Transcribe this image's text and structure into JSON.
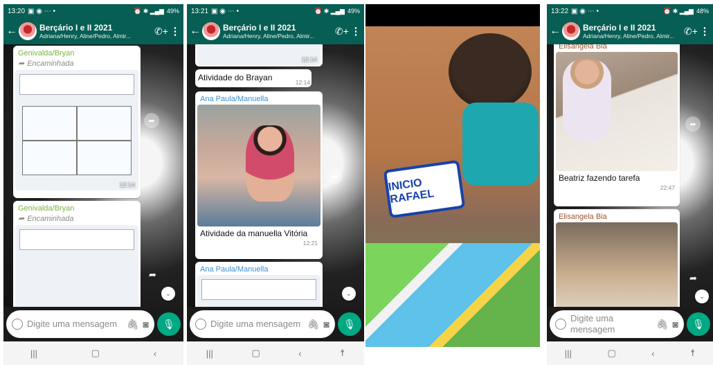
{
  "chat": {
    "title": "Berçário I e II 2021",
    "subtitle": "Adriana/Henry, Aline/Pedro, Almir..."
  },
  "input": {
    "placeholder": "Digite uma mensagem"
  },
  "screens": [
    {
      "status_time": "13:20",
      "battery": "49%",
      "messages": [
        {
          "sender": "Genivalda/Bryan",
          "forwarded": "Encaminhada",
          "time": "12:14"
        },
        {
          "sender": "Genivalda/Bryan",
          "forwarded": "Encaminhada"
        }
      ]
    },
    {
      "status_time": "13:21",
      "battery": "49%",
      "messages": [
        {
          "time": "12:14"
        },
        {
          "caption": "Atividade do Brayan",
          "time": "12:14"
        },
        {
          "sender": "Ana Paula/Manuella",
          "caption": "Atividade da manuella Vitória",
          "time": "12:21"
        },
        {
          "sender": "Ana Paula/Manuella"
        }
      ]
    },
    {
      "video_text": "INICIO RAFAEL"
    },
    {
      "status_time": "13:22",
      "battery": "48%",
      "messages": [
        {
          "sender": "Elisangela Bia",
          "caption": "Beatriz fazendo tarefa",
          "time": "22:47"
        },
        {
          "sender": "Elisangela Bia"
        }
      ]
    }
  ],
  "colors": {
    "header": "#075e54",
    "mic": "#00a884",
    "sender_green": "#7cb342",
    "sender_blue": "#3b8fd1",
    "sender_brown": "#a0522d"
  },
  "icons": [
    "back-arrow-icon",
    "add-call-icon",
    "more-vert-icon",
    "forward-icon",
    "emoji-icon",
    "attach-icon",
    "camera-icon",
    "mic-icon",
    "recents-icon",
    "home-icon",
    "back-icon",
    "accessibility-icon",
    "chevron-down-icon",
    "share-icon"
  ]
}
